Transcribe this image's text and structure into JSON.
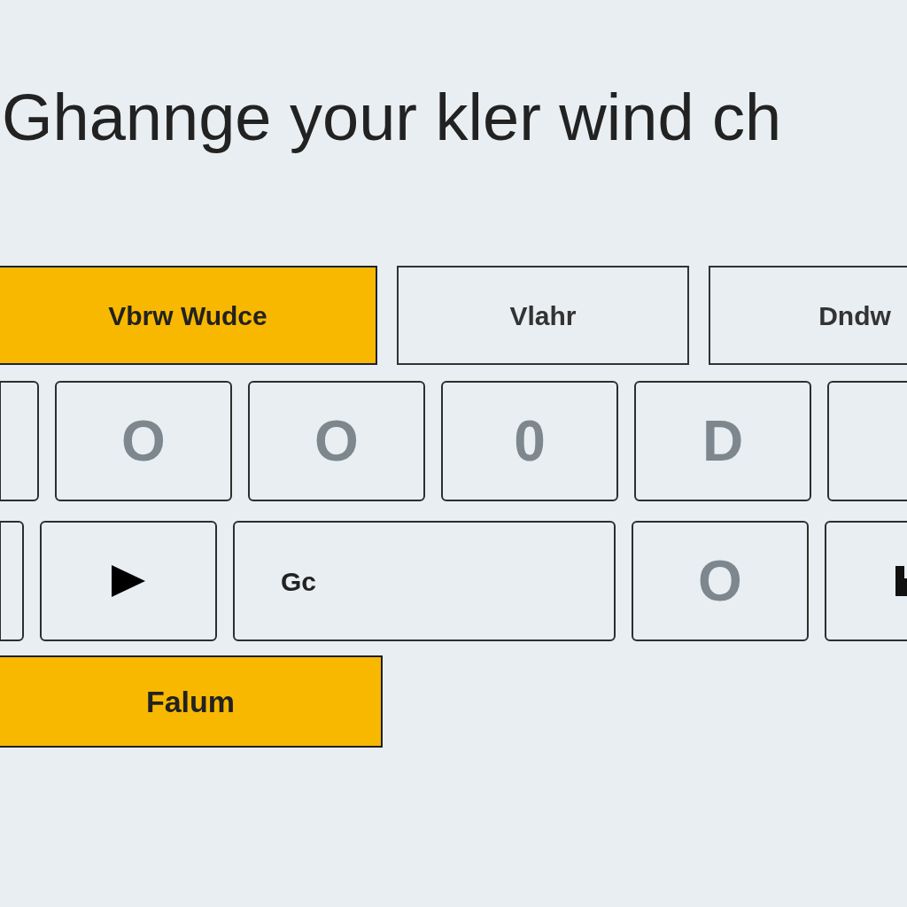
{
  "title": "Ghannge your kler wind ch",
  "tabs": [
    {
      "label": "Vbrw Wudce",
      "selected": true
    },
    {
      "label": "Vlahr",
      "selected": false
    },
    {
      "label": "Dndw",
      "selected": false
    }
  ],
  "key_rows": [
    [
      {
        "kind": "stub"
      },
      {
        "kind": "letter",
        "label": "O"
      },
      {
        "kind": "letter",
        "label": "O"
      },
      {
        "kind": "letter",
        "label": "0"
      },
      {
        "kind": "letter",
        "label": "D"
      },
      {
        "kind": "blank"
      }
    ],
    [
      {
        "kind": "sliver"
      },
      {
        "kind": "play"
      },
      {
        "kind": "wide",
        "label": "Gc"
      },
      {
        "kind": "letter",
        "label": "O"
      },
      {
        "kind": "bar"
      }
    ]
  ],
  "action_button": {
    "label": "Falum"
  }
}
